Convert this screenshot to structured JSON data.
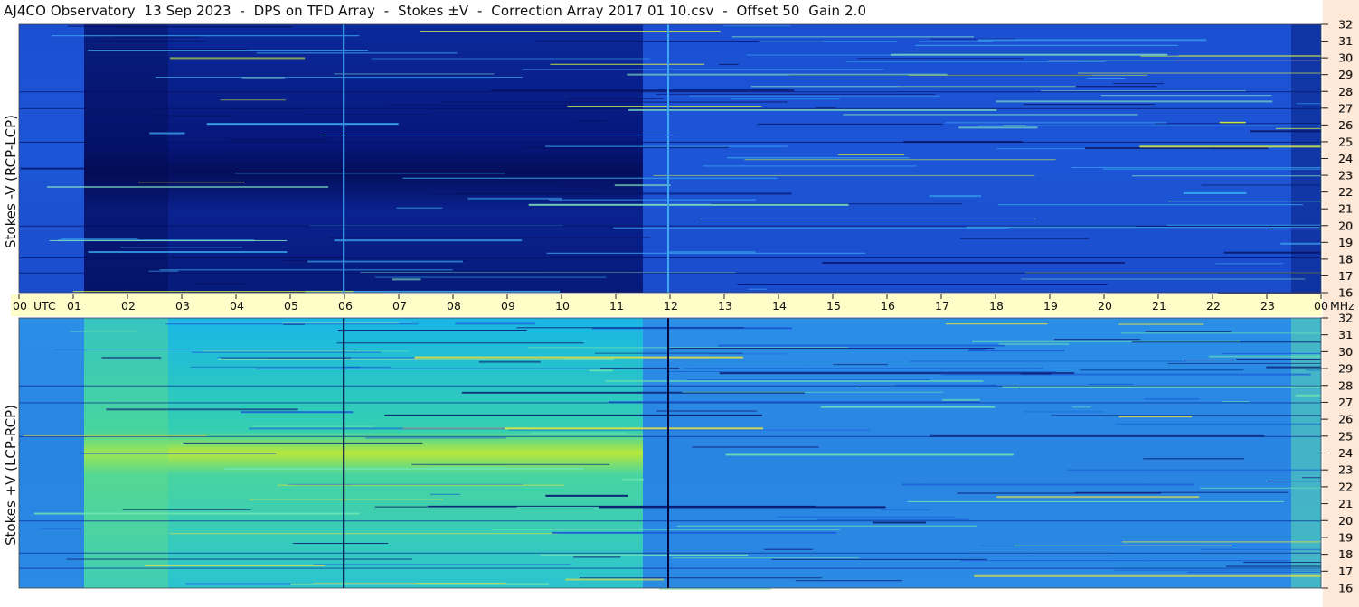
{
  "title": "AJ4CO Observatory  13 Sep 2023  -  DPS on TFD Array  -  Stokes ±V  -  Correction Array 2017 01 10.csv  -  Offset 50  Gain 2.0",
  "chart_data": [
    {
      "type": "heatmap",
      "panel": "top",
      "ylabel": "Stokes -V (RCP-LCP)",
      "y_ticks": [
        "16",
        "17",
        "18",
        "19",
        "20",
        "21",
        "22",
        "23",
        "24",
        "25",
        "26",
        "27",
        "28",
        "29",
        "30",
        "31",
        "32"
      ],
      "ylim": [
        16,
        32
      ],
      "y_unit": "MHz",
      "colormap": "jet (dark blue to red)",
      "dominant_color": "#1e5ad8",
      "dark_band_hours": [
        1.2,
        11.5
      ]
    },
    {
      "type": "heatmap",
      "panel": "bottom",
      "ylabel": "Stokes +V (LCP-RCP)",
      "y_ticks": [
        "16",
        "17",
        "18",
        "19",
        "20",
        "21",
        "22",
        "23",
        "24",
        "25",
        "26",
        "27",
        "28",
        "29",
        "30",
        "31",
        "32"
      ],
      "ylim": [
        16,
        32
      ],
      "y_unit": "MHz",
      "colormap": "jet (dark blue to red)",
      "dominant_color": "#1aa8e0",
      "bright_band_hours": [
        1.2,
        11.5
      ]
    }
  ],
  "time_axis": {
    "ticks": [
      "00",
      "01",
      "02",
      "03",
      "04",
      "05",
      "06",
      "07",
      "08",
      "09",
      "10",
      "11",
      "12",
      "13",
      "14",
      "15",
      "16",
      "17",
      "18",
      "19",
      "20",
      "21",
      "22",
      "23",
      "00"
    ],
    "unit_left": "UTC",
    "unit_right": "MHz",
    "band_color": "#fffdc8"
  }
}
